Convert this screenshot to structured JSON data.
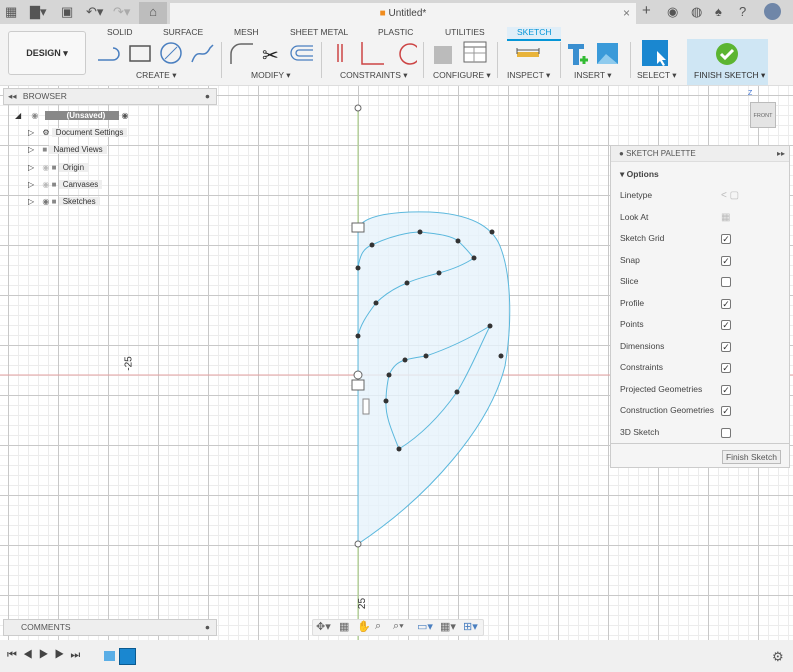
{
  "window": {
    "title": "Untitled*"
  },
  "toolbar": {
    "apps_icon": "grid-icon",
    "file_icon": "file-icon",
    "save_icon": "save-icon",
    "undo_icon": "undo-icon",
    "redo_icon": "redo-icon",
    "home_icon": "home-icon"
  },
  "header_icons": [
    "plus-icon",
    "extensions-icon",
    "job-status-icon",
    "bell-icon",
    "help-icon",
    "avatar"
  ],
  "workspace": {
    "label": "DESIGN ▾"
  },
  "tabs": [
    {
      "label": "SOLID"
    },
    {
      "label": "SURFACE"
    },
    {
      "label": "MESH"
    },
    {
      "label": "SHEET METAL"
    },
    {
      "label": "PLASTIC"
    },
    {
      "label": "UTILITIES"
    },
    {
      "label": "SKETCH",
      "active": true
    }
  ],
  "groups": [
    {
      "label": "CREATE ▾"
    },
    {
      "label": "MODIFY ▾"
    },
    {
      "label": "CONSTRAINTS ▾"
    },
    {
      "label": "CONFIGURE ▾"
    },
    {
      "label": "INSPECT ▾"
    },
    {
      "label": "INSERT ▾"
    },
    {
      "label": "SELECT ▾"
    },
    {
      "label": "FINISH SKETCH ▾"
    }
  ],
  "browser": {
    "title": "BROWSER",
    "root": "(Unsaved)",
    "items": [
      {
        "label": "Document Settings"
      },
      {
        "label": "Named Views"
      },
      {
        "label": "Origin"
      },
      {
        "label": "Canvases"
      },
      {
        "label": "Sketches"
      }
    ]
  },
  "comments": {
    "title": "COMMENTS"
  },
  "viewcube": {
    "face": "FRONT",
    "axis": "Z"
  },
  "dimensions": {
    "vertical": "-25",
    "horizontal": "25"
  },
  "palette": {
    "title": "SKETCH PALETTE",
    "section": "Options",
    "rows": [
      {
        "label": "Linetype",
        "type": "icons"
      },
      {
        "label": "Look At",
        "type": "icon"
      },
      {
        "label": "Sketch Grid",
        "checked": true
      },
      {
        "label": "Snap",
        "checked": true
      },
      {
        "label": "Slice",
        "checked": false
      },
      {
        "label": "Profile",
        "checked": true
      },
      {
        "label": "Points",
        "checked": true
      },
      {
        "label": "Dimensions",
        "checked": true
      },
      {
        "label": "Constraints",
        "checked": true
      },
      {
        "label": "Projected Geometries",
        "checked": true
      },
      {
        "label": "Construction Geometries",
        "checked": true
      },
      {
        "label": "3D Sketch",
        "checked": false
      }
    ],
    "finish_button": "Finish Sketch"
  },
  "colors": {
    "accent": "#0696d7",
    "sketch_line": "#5bb8dd",
    "profile_fill": "#e6f3fb",
    "x_axis": "#e08a8a",
    "y_axis": "#8cc36a",
    "finish_green": "#5cb531"
  }
}
